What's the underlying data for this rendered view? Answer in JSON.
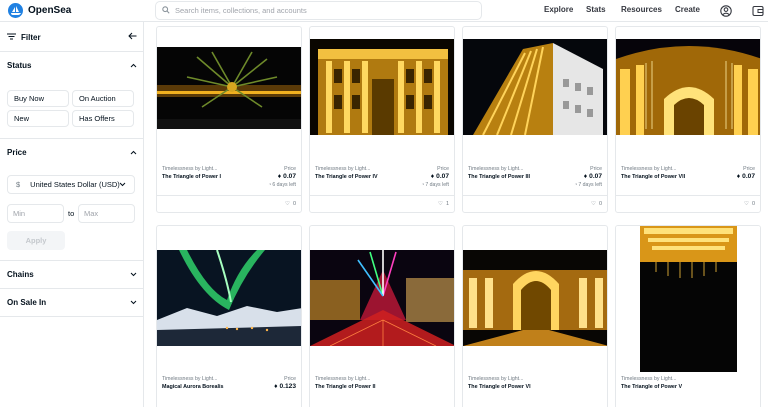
{
  "header": {
    "brand": "OpenSea",
    "search_placeholder": "Search items, collections, and accounts",
    "nav": [
      "Explore",
      "Stats",
      "Resources",
      "Create"
    ]
  },
  "sidebar": {
    "filter_label": "Filter",
    "status": {
      "title": "Status",
      "chips": [
        "Buy Now",
        "On Auction",
        "New",
        "Has Offers"
      ]
    },
    "price": {
      "title": "Price",
      "currency": "United States Dollar (USD)",
      "currency_symbol": "$",
      "min_placeholder": "Min",
      "to_label": "to",
      "max_placeholder": "Max",
      "apply_label": "Apply"
    },
    "chains_title": "Chains",
    "on_sale_title": "On Sale In"
  },
  "cards": [
    {
      "collection": "Timelessness by Light...",
      "name": "The Triangle of Power I",
      "price_label": "Price",
      "price": "0.07",
      "days": "6 days left",
      "favorites": "0"
    },
    {
      "collection": "Timelessness by Light...",
      "name": "The Triangle of Power IV",
      "price_label": "Price",
      "price": "0.07",
      "days": "7 days left",
      "favorites": "1"
    },
    {
      "collection": "Timelessness by Light...",
      "name": "The Triangle of Power III",
      "price_label": "Price",
      "price": "0.07",
      "days": "7 days left",
      "favorites": "0"
    },
    {
      "collection": "Timelessness by Light...",
      "name": "The Triangle of Power VII",
      "price_label": "Price",
      "price": "0.07",
      "days": "",
      "favorites": "0"
    },
    {
      "collection": "Timelessness by Light...",
      "name": "Magical Aurora Borealis",
      "price_label": "Price",
      "price": "0.123"
    },
    {
      "collection": "Timelessness by Light...",
      "name": "The Triangle of Power II"
    },
    {
      "collection": "Timelessness by Light...",
      "name": "The Triangle of Power VI"
    },
    {
      "collection": "Timelessness by Light...",
      "name": "The Triangle of Power V"
    }
  ],
  "colors": {
    "brand": "#2081e2",
    "border": "#e5e8eb",
    "text": "#04111d",
    "muted": "#707a83"
  }
}
